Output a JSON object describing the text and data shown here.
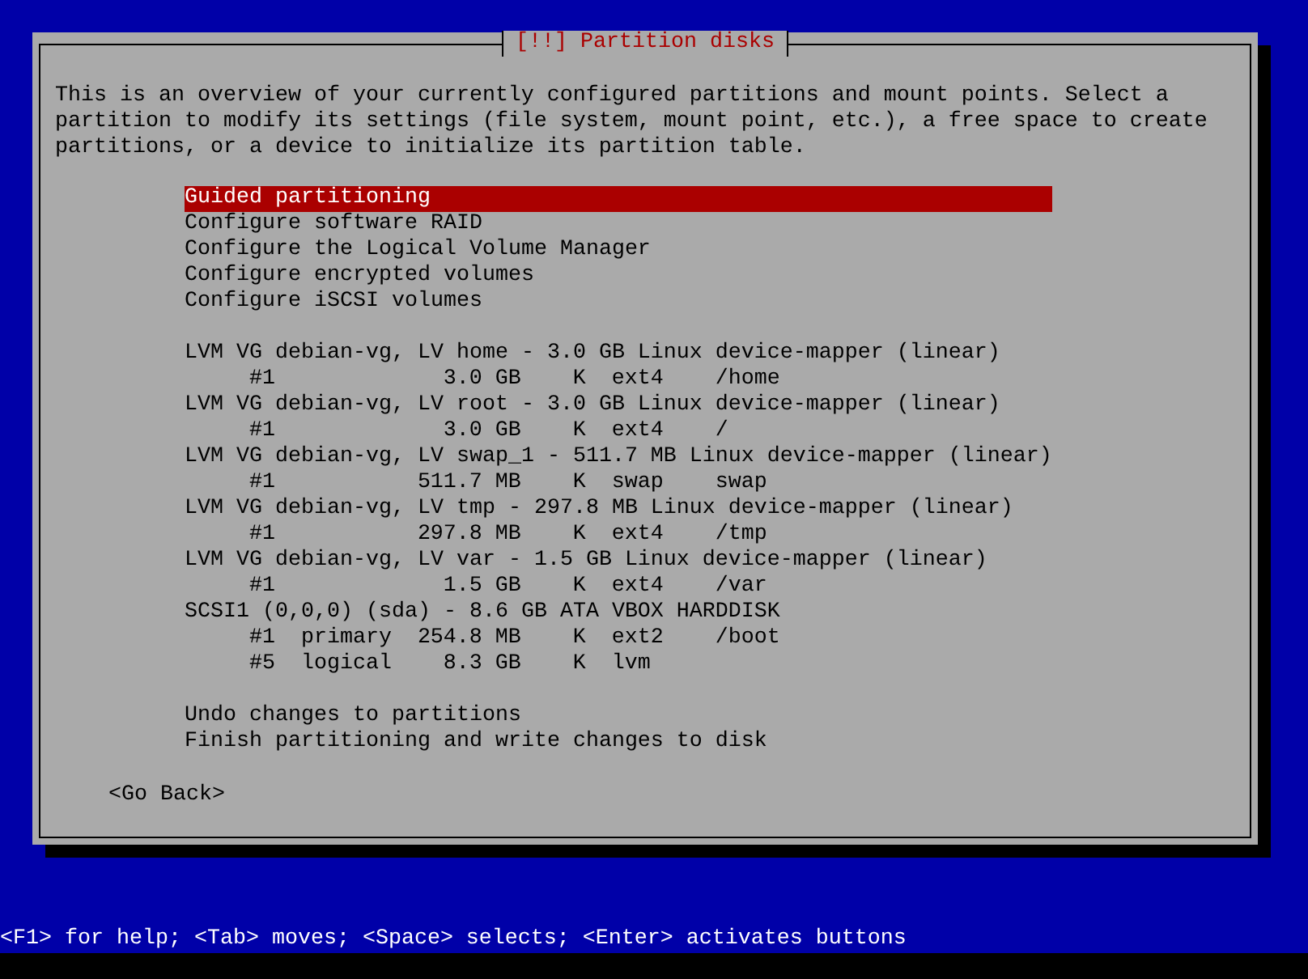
{
  "dialog": {
    "title": "[!!] Partition disks",
    "description": "This is an overview of your currently configured partitions and mount points. Select a partition to modify its settings (file system, mount point, etc.), a free space to create partitions, or a device to initialize its partition table.",
    "menu": [
      {
        "label": "Guided partitioning",
        "selected": true
      },
      {
        "label": "Configure software RAID",
        "selected": false
      },
      {
        "label": "Configure the Logical Volume Manager",
        "selected": false
      },
      {
        "label": "Configure encrypted volumes",
        "selected": false
      },
      {
        "label": "Configure iSCSI volumes",
        "selected": false
      }
    ],
    "devices": [
      {
        "label": "LVM VG debian-vg, LV home - 3.0 GB Linux device-mapper (linear)",
        "selected": false,
        "partitions": [
          {
            "number": "#1",
            "size": "3.0 GB",
            "flag": "K",
            "filesystem": "ext4",
            "mount": "/home",
            "selected": false
          }
        ]
      },
      {
        "label": "LVM VG debian-vg, LV root - 3.0 GB Linux device-mapper (linear)",
        "selected": false,
        "partitions": [
          {
            "number": "#1",
            "size": "3.0 GB",
            "flag": "K",
            "filesystem": "ext4",
            "mount": "/",
            "selected": false
          }
        ]
      },
      {
        "label": "LVM VG debian-vg, LV swap_1 - 511.7 MB Linux device-mapper (linear)",
        "selected": false,
        "partitions": [
          {
            "number": "#1",
            "size": "511.7 MB",
            "flag": "K",
            "filesystem": "swap",
            "mount": "swap",
            "selected": false
          }
        ]
      },
      {
        "label": "LVM VG debian-vg, LV tmp - 297.8 MB Linux device-mapper (linear)",
        "selected": false,
        "partitions": [
          {
            "number": "#1",
            "size": "297.8 MB",
            "flag": "K",
            "filesystem": "ext4",
            "mount": "/tmp",
            "selected": false
          }
        ]
      },
      {
        "label": "LVM VG debian-vg, LV var - 1.5 GB Linux device-mapper (linear)",
        "selected": false,
        "partitions": [
          {
            "number": "#1",
            "size": "1.5 GB",
            "flag": "K",
            "filesystem": "ext4",
            "mount": "/var",
            "selected": false
          }
        ]
      },
      {
        "label": "SCSI1 (0,0,0) (sda) - 8.6 GB ATA VBOX HARDDISK",
        "selected": false,
        "partitions": [
          {
            "number": "#1",
            "type": "primary",
            "size": "254.8 MB",
            "flag": "K",
            "filesystem": "ext2",
            "mount": "/boot",
            "selected": false
          },
          {
            "number": "#5",
            "type": "logical",
            "size": "8.3 GB",
            "flag": "K",
            "filesystem": "lvm",
            "selected": false
          }
        ]
      }
    ],
    "actions": [
      {
        "label": "Undo changes to partitions",
        "selected": false
      },
      {
        "label": "Finish partitioning and write changes to disk",
        "selected": false
      }
    ],
    "back_button": "<Go Back>"
  },
  "status_bar": "<F1> for help; <Tab> moves; <Space> selects; <Enter> activates buttons"
}
